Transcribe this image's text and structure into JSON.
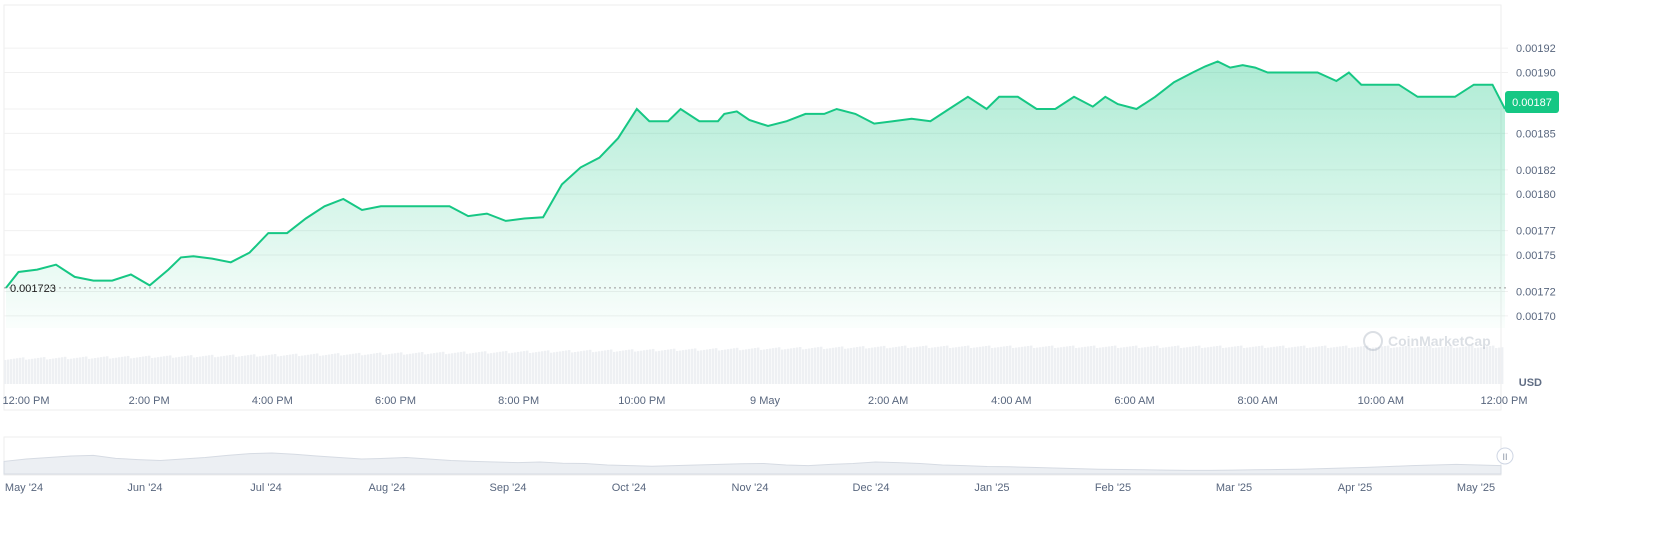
{
  "chart_data": {
    "type": "area",
    "currency_label": "USD",
    "watermark": "CoinMarketCap",
    "current_price_label": "0.00187",
    "start_price_label": "0.001723",
    "y_axis": {
      "min": 0.00169,
      "max": 0.00193,
      "ticks": [
        "0.00192",
        "0.00190",
        "0.00187",
        "0.00185",
        "0.00182",
        "0.00180",
        "0.00177",
        "0.00175",
        "0.00172",
        "0.00170"
      ]
    },
    "x_tick_labels": [
      "12:00 PM",
      "2:00 PM",
      "4:00 PM",
      "6:00 PM",
      "8:00 PM",
      "10:00 PM",
      "9 May",
      "2:00 AM",
      "4:00 AM",
      "6:00 AM",
      "8:00 AM",
      "10:00 AM",
      "12:00 PM"
    ],
    "overview_tick_labels": [
      "May '24",
      "Jun '24",
      "Jul '24",
      "Aug '24",
      "Sep '24",
      "Oct '24",
      "Nov '24",
      "Dec '24",
      "Jan '25",
      "Feb '25",
      "Mar '25",
      "Apr '25",
      "May '25"
    ],
    "x_range_hours": [
      0,
      24
    ],
    "series": [
      {
        "x": [
          0,
          0.2,
          0.5,
          0.8,
          1.1,
          1.4,
          1.7,
          2.0,
          2.3,
          2.6,
          2.8,
          3.0,
          3.3,
          3.6,
          3.9,
          4.2,
          4.5,
          4.8,
          5.1,
          5.4,
          5.7,
          6.0,
          6.3,
          6.5,
          6.8,
          7.1,
          7.4,
          7.7,
          8.0,
          8.3,
          8.6,
          8.9,
          9.2,
          9.5,
          9.8,
          10.1,
          10.3,
          10.6,
          10.8,
          11.1,
          11.4,
          11.5,
          11.7,
          11.9,
          12.2,
          12.5,
          12.8,
          13.1,
          13.3,
          13.6,
          13.9,
          14.2,
          14.5,
          14.8,
          15.1,
          15.4,
          15.7,
          15.9,
          16.2,
          16.5,
          16.8,
          17.1,
          17.4,
          17.6,
          17.8,
          18.1,
          18.4,
          18.7,
          19.0,
          19.2,
          19.4,
          19.6,
          19.8,
          20.0,
          20.2,
          20.4,
          20.7,
          21.0,
          21.3,
          21.5,
          21.7,
          22.0,
          22.3,
          22.6,
          22.9,
          23.2,
          23.5,
          23.8,
          24.0
        ],
        "y": [
          0.001723,
          0.001736,
          0.001738,
          0.001742,
          0.001732,
          0.001729,
          0.001729,
          0.001734,
          0.001725,
          0.001738,
          0.001748,
          0.001749,
          0.001747,
          0.001744,
          0.001752,
          0.001768,
          0.001768,
          0.00178,
          0.00179,
          0.001796,
          0.001787,
          0.00179,
          0.00179,
          0.00179,
          0.00179,
          0.00179,
          0.001782,
          0.001784,
          0.001778,
          0.00178,
          0.001781,
          0.001808,
          0.001822,
          0.00183,
          0.001846,
          0.00187,
          0.00186,
          0.00186,
          0.00187,
          0.00186,
          0.00186,
          0.001866,
          0.001868,
          0.001861,
          0.001856,
          0.00186,
          0.001866,
          0.001866,
          0.00187,
          0.001866,
          0.001858,
          0.00186,
          0.001862,
          0.00186,
          0.00187,
          0.00188,
          0.00187,
          0.00188,
          0.00188,
          0.00187,
          0.00187,
          0.00188,
          0.001872,
          0.00188,
          0.001874,
          0.00187,
          0.00188,
          0.001892,
          0.0019,
          0.001905,
          0.001909,
          0.001904,
          0.001906,
          0.001904,
          0.0019,
          0.0019,
          0.0019,
          0.0019,
          0.001893,
          0.0019,
          0.00189,
          0.00189,
          0.00189,
          0.00188,
          0.00188,
          0.00188,
          0.00189,
          0.00189,
          0.00187
        ]
      }
    ],
    "overview_series": [
      0.42,
      0.5,
      0.55,
      0.6,
      0.62,
      0.52,
      0.48,
      0.45,
      0.5,
      0.55,
      0.62,
      0.68,
      0.7,
      0.66,
      0.6,
      0.55,
      0.5,
      0.52,
      0.55,
      0.5,
      0.45,
      0.42,
      0.4,
      0.38,
      0.4,
      0.36,
      0.35,
      0.3,
      0.28,
      0.26,
      0.28,
      0.3,
      0.32,
      0.34,
      0.35,
      0.3,
      0.28,
      0.32,
      0.35,
      0.4,
      0.38,
      0.35,
      0.3,
      0.28,
      0.25,
      0.24,
      0.22,
      0.2,
      0.18,
      0.16,
      0.15,
      0.14,
      0.13,
      0.12,
      0.12,
      0.13,
      0.14,
      0.15,
      0.16,
      0.18,
      0.2,
      0.22,
      0.25,
      0.28,
      0.3,
      0.32,
      0.3,
      0.28
    ]
  }
}
